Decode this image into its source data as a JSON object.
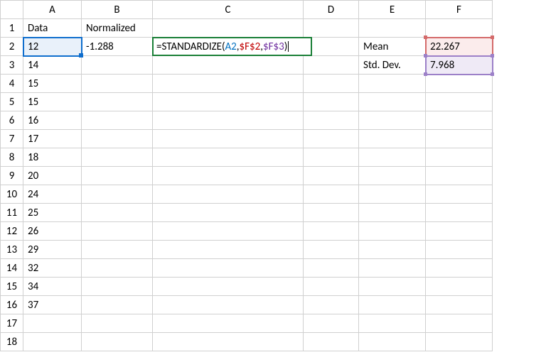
{
  "columns": [
    "A",
    "B",
    "C",
    "D",
    "E",
    "F"
  ],
  "rowCount": 18,
  "headers": {
    "A1": "Data",
    "B1": "Normalized",
    "E2": "Mean",
    "E3": "Std. Dev."
  },
  "dataA": [
    "12",
    "14",
    "15",
    "15",
    "16",
    "17",
    "18",
    "20",
    "24",
    "25",
    "26",
    "29",
    "32",
    "34",
    "37"
  ],
  "B2": "-1.288",
  "F2": "22.267",
  "F3": "7.968",
  "formula": {
    "prefix": "=STANDARDIZE(",
    "arg1": "A2",
    "sep1": ", ",
    "arg2": "$F$2",
    "sep2": ", ",
    "arg3": "$F$3",
    "suffix": ")"
  }
}
